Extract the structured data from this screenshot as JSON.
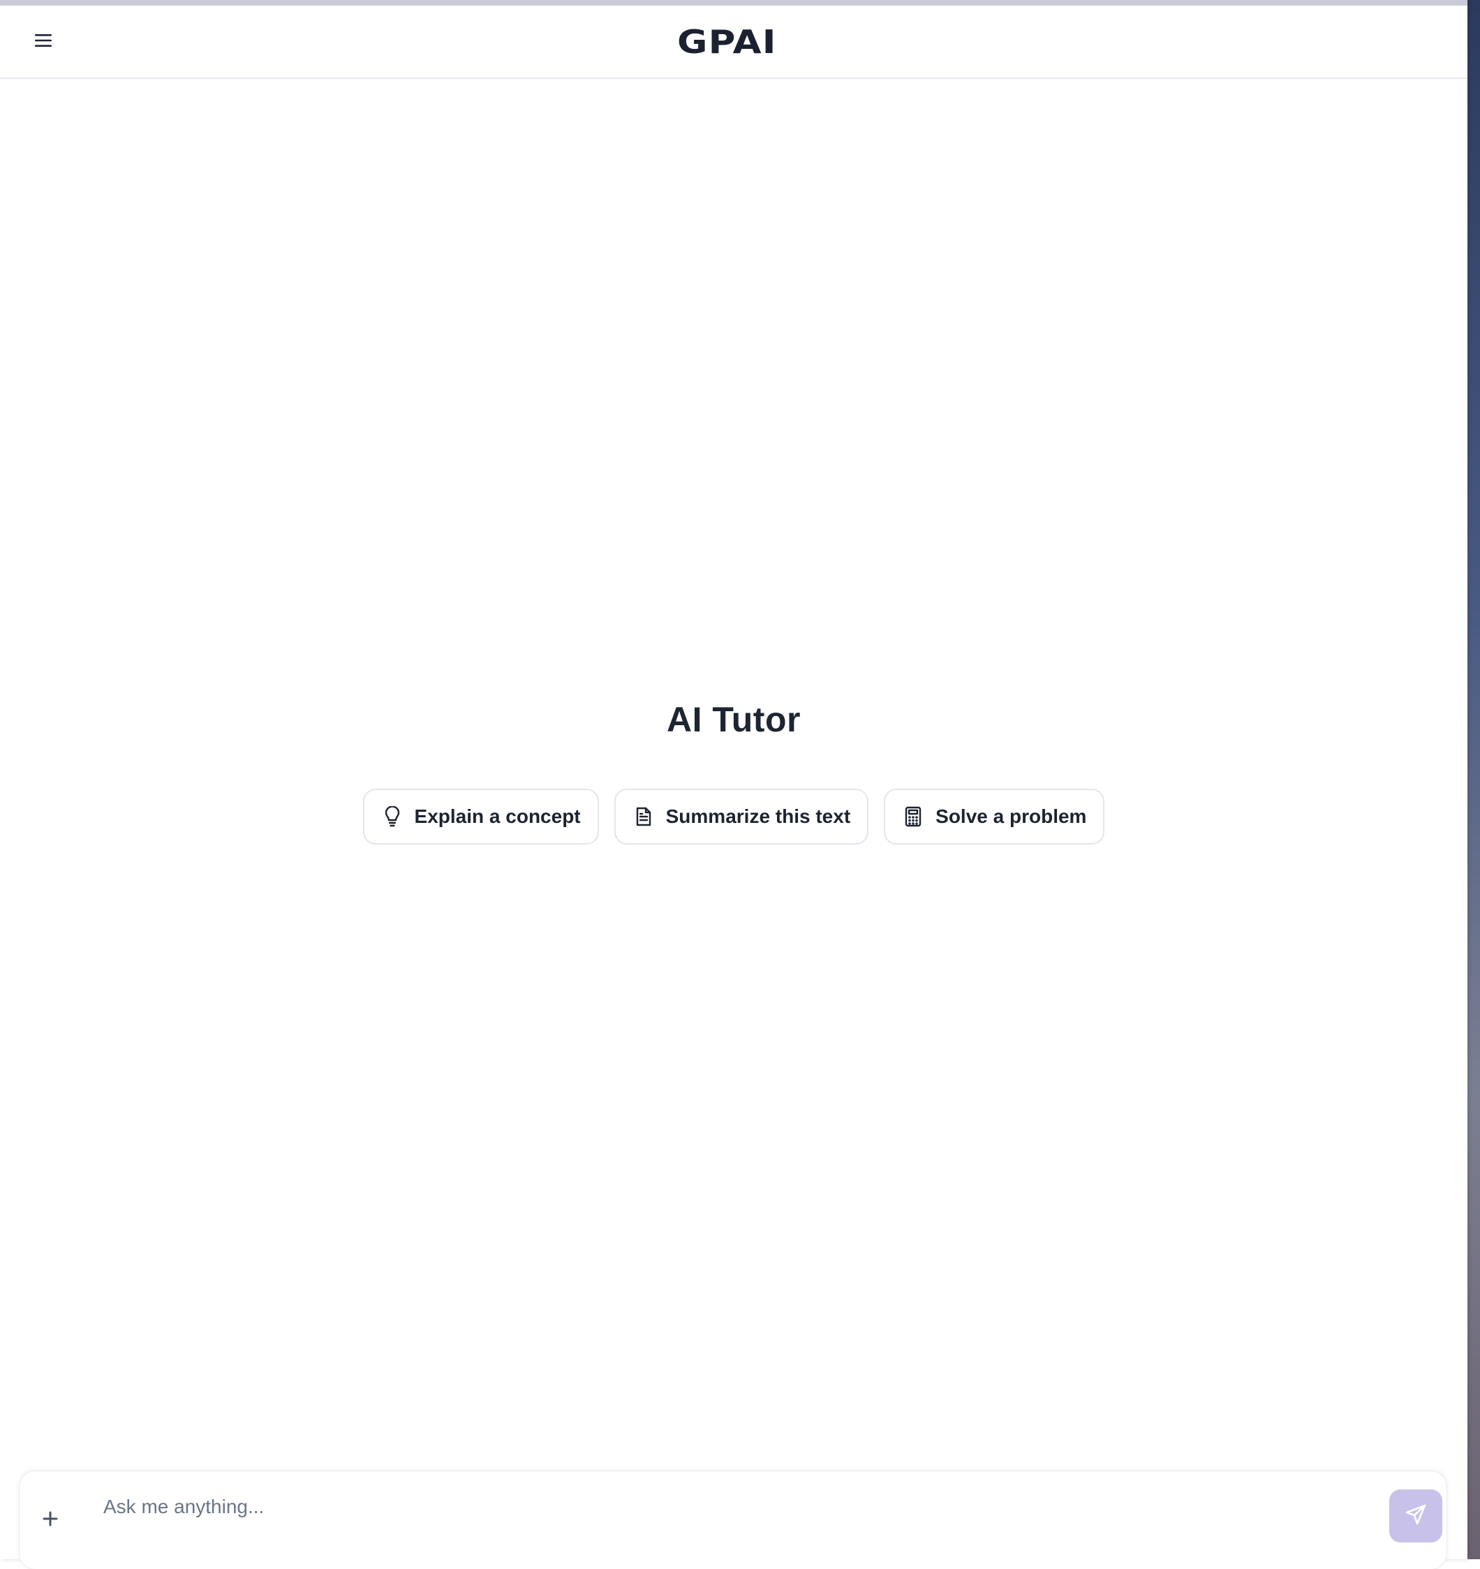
{
  "header": {
    "logo_text": "GPAI",
    "menu_icon": "hamburger-menu-icon"
  },
  "main": {
    "title": "AI Tutor",
    "suggestions": [
      {
        "label": "Explain a concept",
        "icon": "lightbulb-icon"
      },
      {
        "label": "Summarize this text",
        "icon": "document-icon"
      },
      {
        "label": "Solve a problem",
        "icon": "calculator-icon"
      }
    ]
  },
  "composer": {
    "placeholder": "Ask me anything...",
    "value": "",
    "attach_icon": "plus-icon",
    "send_icon": "send-icon"
  },
  "colors": {
    "send_button_bg": "#c8c2ea",
    "text_primary": "#1d2330",
    "border": "#e3e5ea"
  }
}
